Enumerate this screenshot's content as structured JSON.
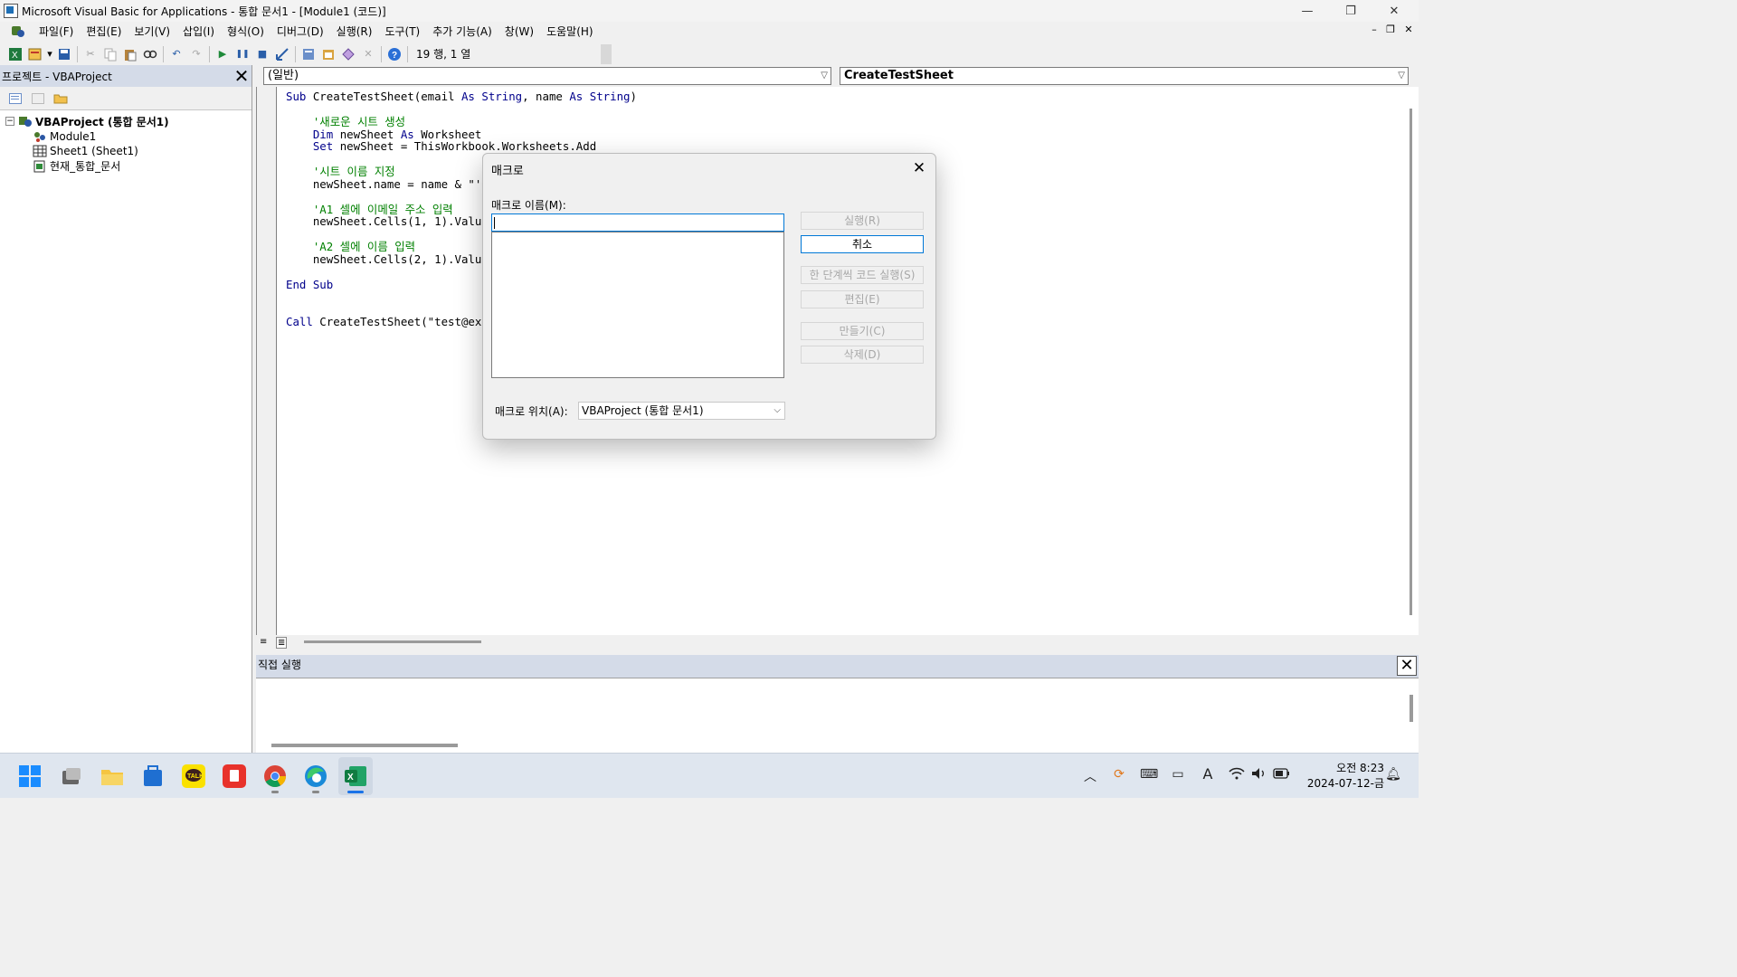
{
  "titlebar": {
    "title": "Microsoft Visual Basic for Applications - 통합 문서1 - [Module1 (코드)]",
    "minimize": "—",
    "restore": "❐",
    "close": "✕"
  },
  "menu": [
    "파일(F)",
    "편집(E)",
    "보기(V)",
    "삽입(I)",
    "형식(O)",
    "디버그(D)",
    "실행(R)",
    "도구(T)",
    "추가 기능(A)",
    "창(W)",
    "도움말(H)"
  ],
  "mdi": {
    "minimize": "–",
    "restore": "❐",
    "close": "✕"
  },
  "toolbar": {
    "position": "19 행, 1 열",
    "icons": [
      "excel-icon",
      "insert-module-icon",
      "save-icon",
      "cut-icon",
      "copy-icon",
      "paste-icon",
      "find-icon",
      "undo-icon",
      "redo-icon",
      "run-icon",
      "break-icon",
      "reset-icon",
      "design-mode-icon",
      "project-explorer-icon",
      "properties-icon",
      "object-browser-icon",
      "toolbox-icon",
      "help-icon"
    ]
  },
  "project": {
    "title": "프로젝트 - VBAProject",
    "close": "✕",
    "tree": [
      {
        "label": "VBAProject (통합 문서1)",
        "level": 0,
        "icon": "vbaproject-icon",
        "bold": true
      },
      {
        "label": "Module1",
        "level": 1,
        "icon": "module-icon"
      },
      {
        "label": "Sheet1 (Sheet1)",
        "level": 1,
        "icon": "sheet-icon"
      },
      {
        "label": "현재_통합_문서",
        "level": 1,
        "icon": "workbook-icon"
      }
    ]
  },
  "code": {
    "object_combo": "(일반)",
    "procedure_combo": "CreateTestSheet",
    "lines": [
      [
        [
          "kw",
          "Sub"
        ],
        [
          "t",
          " CreateTestSheet(email "
        ],
        [
          "kw",
          "As"
        ],
        [
          "t",
          " "
        ],
        [
          "kw",
          "String"
        ],
        [
          "t",
          ", name "
        ],
        [
          "kw",
          "As"
        ],
        [
          "t",
          " "
        ],
        [
          "kw",
          "String"
        ],
        [
          "t",
          ")"
        ]
      ],
      [],
      [
        [
          "cm",
          "    '새로운 시트 생성"
        ]
      ],
      [
        [
          "t",
          "    "
        ],
        [
          "kw",
          "Dim"
        ],
        [
          "t",
          " newSheet "
        ],
        [
          "kw",
          "As"
        ],
        [
          "t",
          " Worksheet"
        ]
      ],
      [
        [
          "t",
          "    "
        ],
        [
          "kw",
          "Set"
        ],
        [
          "t",
          " newSheet = ThisWorkbook.Worksheets.Add"
        ]
      ],
      [],
      [
        [
          "cm",
          "    '시트 이름 지정"
        ]
      ],
      [
        [
          "t",
          "    newSheet.name = name & \"'s"
        ]
      ],
      [],
      [
        [
          "cm",
          "    'A1 셀에 이메일 주소 입력"
        ]
      ],
      [
        [
          "t",
          "    newSheet.Cells(1, 1).Value"
        ]
      ],
      [],
      [
        [
          "cm",
          "    'A2 셀에 이름 입력"
        ]
      ],
      [
        [
          "t",
          "    newSheet.Cells(2, 1).Value"
        ]
      ],
      [],
      [
        [
          "kw",
          "End Sub"
        ]
      ],
      [],
      [],
      [
        [
          "kw",
          "Call"
        ],
        [
          "t",
          " CreateTestSheet(\"test@exa"
        ]
      ]
    ]
  },
  "immediate": {
    "title": "직접 실행",
    "close": "✕"
  },
  "dialog": {
    "title": "매크로",
    "close": "✕",
    "name_label": "매크로 이름(M):",
    "name_value": "",
    "buttons": {
      "run": "실행(R)",
      "cancel": "취소",
      "step": "한 단계씩 코드 실행(S)",
      "edit": "편집(E)",
      "create": "만들기(C)",
      "delete": "삭제(D)"
    },
    "location_label": "매크로 위치(A):",
    "location_value": "VBAProject (통합 문서1)"
  },
  "taskbar": {
    "apps": [
      "start-icon",
      "task-view-icon",
      "file-explorer-icon",
      "microsoft-store-icon",
      "kakaotalk-icon",
      "acrobat-icon",
      "chrome-icon",
      "edge-icon",
      "excel-icon"
    ],
    "tray": [
      "chevron-up-icon",
      "sync-icon",
      "keyboard-icon",
      "touchpad-icon",
      "ime-icon",
      "wifi-icon",
      "volume-icon",
      "battery-icon"
    ],
    "ime_label": "A",
    "time": "오전 8:23",
    "date": "2024-07-12-금"
  },
  "colors": {
    "keyword": "#00008b",
    "comment": "#008000",
    "panel_title": "#d4dbe8",
    "accent": "#0078d7"
  }
}
